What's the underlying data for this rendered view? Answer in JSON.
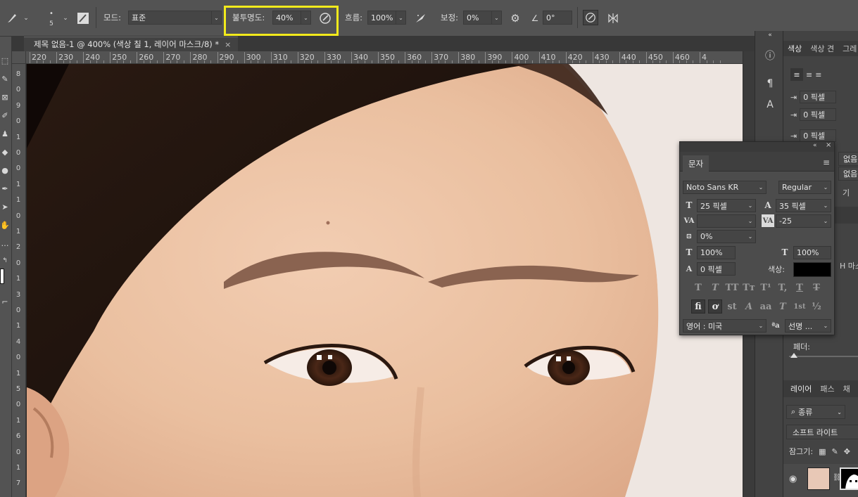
{
  "options": {
    "brush_size": "5",
    "mode_label": "모드:",
    "mode_value": "표준",
    "opacity_label": "불투명도:",
    "opacity_value": "40%",
    "flow_label": "흐름:",
    "flow_value": "100%",
    "smoothing_label": "보정:",
    "smoothing_value": "0%",
    "angle_value": "0°"
  },
  "document": {
    "tab_title": "제목 없음-1 @ 400% (색상 칠 1, 레이어 마스크/8) *",
    "close": "×"
  },
  "ruler": {
    "h": [
      "220",
      "230",
      "240",
      "250",
      "260",
      "270",
      "280",
      "290",
      "300",
      "310",
      "320",
      "330",
      "340",
      "350",
      "360",
      "370",
      "380",
      "390",
      "400",
      "410",
      "420",
      "430",
      "440",
      "450",
      "460",
      "4"
    ],
    "v": [
      {
        "label": "8"
      },
      {
        "label": "0"
      },
      {
        "label": "9"
      },
      {
        "label": "0"
      },
      {
        "label": "1"
      },
      {
        "label": "0"
      },
      {
        "label": "0"
      },
      {
        "label": "1"
      },
      {
        "label": "1"
      },
      {
        "label": "0"
      },
      {
        "label": "1"
      },
      {
        "label": "2"
      },
      {
        "label": "0"
      },
      {
        "label": "1"
      },
      {
        "label": "3"
      },
      {
        "label": "0"
      },
      {
        "label": "1"
      },
      {
        "label": "4"
      },
      {
        "label": "0"
      },
      {
        "label": "1"
      },
      {
        "label": "5"
      },
      {
        "label": "0"
      },
      {
        "label": "1"
      },
      {
        "label": "6"
      },
      {
        "label": "0"
      },
      {
        "label": "1"
      },
      {
        "label": "7"
      }
    ]
  },
  "right_panel": {
    "tabs": [
      "색상",
      "색상 견",
      "그레"
    ],
    "indent_values": [
      "0 픽셀",
      "0 픽셀",
      "0 픽셀"
    ],
    "dropdown_a": "없음",
    "dropdown_b": "없음",
    "partial_a": "기",
    "partial_b": "H 마스",
    "feather_label": "페더:",
    "layer_tabs": [
      "레이어",
      "패스",
      "채"
    ],
    "kind_filter": "종류",
    "blend_mode": "소프트 라이트",
    "lock_label": "잠그기:"
  },
  "character_panel": {
    "tab": "문자",
    "font_family": "Noto Sans KR",
    "font_style": "Regular",
    "font_size": "25 픽셀",
    "leading": "35 픽셀",
    "kerning": "",
    "tracking": "-25",
    "tsume": "0%",
    "vertical_scale": "100%",
    "horizontal_scale": "100%",
    "baseline_shift": "0 픽셀",
    "color_label": "색상:",
    "color": "#000000",
    "language": "영어 : 미국",
    "antialias": "선명 ...",
    "style_buttons": [
      "T",
      "T",
      "TT",
      "Tт",
      "T¹",
      "T,",
      "T",
      "T"
    ],
    "opentype_buttons": [
      "fi",
      "ơ",
      "st",
      "A",
      "aa",
      "T",
      "1st",
      "½"
    ]
  }
}
